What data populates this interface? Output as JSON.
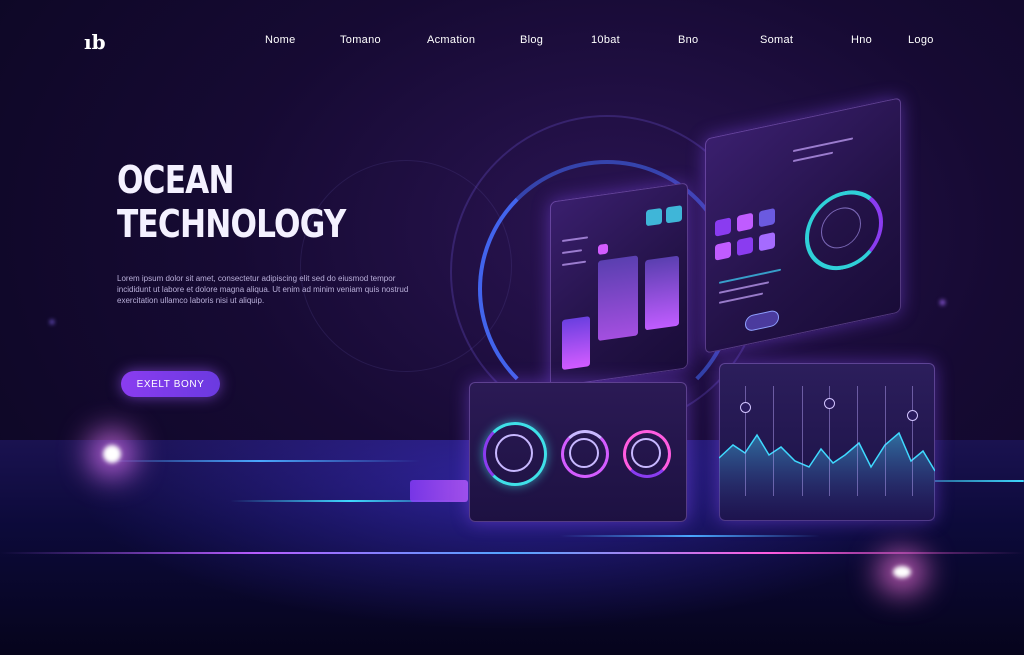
{
  "header": {
    "logo_text": "ıb",
    "nav": [
      "Nome",
      "Tomano",
      "Acmation",
      "Blog",
      "10bat",
      "Bno",
      "Somat",
      "Hno",
      "Logo"
    ]
  },
  "hero": {
    "title_line1": "OCEAN",
    "title_line2": "TECHNOLOGY",
    "description": "Lorem ipsum dolor sit amet, consectetur adipiscing elit sed do eiusmod tempor incididunt ut labore et dolore magna aliqua. Ut enim ad minim veniam quis nostrud exercitation ullamco laboris nisi ut aliquip.",
    "cta_label": "EXELT BONY"
  },
  "colors": {
    "accent": "#8a3cf0",
    "cyan": "#3fe0e8",
    "magenta": "#d35cff",
    "background": "#160a33"
  },
  "icons": {
    "logo": "brand-logo-icon",
    "gauge": "circular-gauge-icon",
    "chart": "line-chart-icon"
  }
}
